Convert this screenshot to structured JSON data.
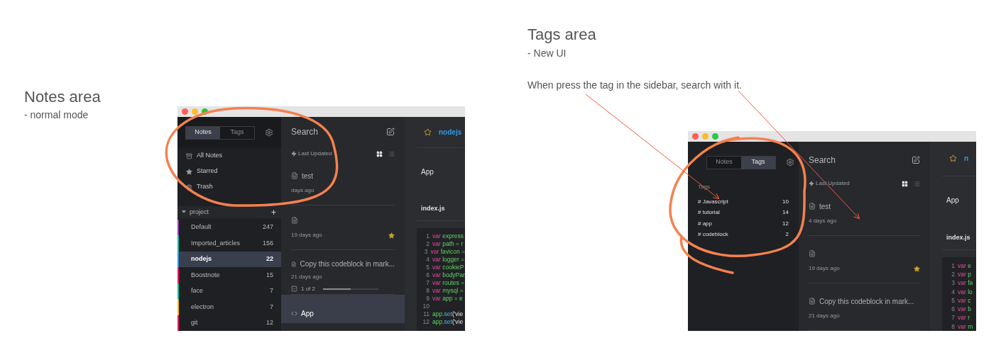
{
  "notes_section": {
    "title": "Notes area",
    "subtitle": "- normal mode",
    "window": {
      "toggle": [
        {
          "label": "Notes",
          "selected": true
        },
        {
          "label": "Tags",
          "selected": false
        }
      ],
      "sidebar": {
        "kind": "notes",
        "nav": [
          {
            "kind": "all",
            "label": "All Notes"
          },
          {
            "kind": "star",
            "label": "Starred"
          },
          {
            "kind": "trash",
            "label": "Trash"
          }
        ],
        "folder_group": {
          "label": "project",
          "expanded": true
        },
        "folders": [
          {
            "name": "Default",
            "count": "247",
            "color": "#8e44ad",
            "selected": false
          },
          {
            "name": "Imported_articles",
            "count": "156",
            "color": "#1abc9c",
            "selected": false
          },
          {
            "name": "nodejs",
            "count": "22",
            "color": "#3498db",
            "selected": true
          },
          {
            "name": "Boostnote",
            "count": "15",
            "color": "#e91e63",
            "selected": false
          },
          {
            "name": "face",
            "count": "7",
            "color": "#1abc9c",
            "selected": false
          },
          {
            "name": "electron",
            "count": "7",
            "color": "#f1c40f",
            "selected": false
          },
          {
            "name": "git",
            "count": "12",
            "color": "#e91e63",
            "selected": false
          }
        ]
      },
      "note_list": {
        "title": "Search",
        "sort_label": "Last Updated",
        "views": [
          {
            "kind": "grid",
            "selected": true
          },
          {
            "kind": "list",
            "selected": false
          }
        ],
        "notes": [
          {
            "kind": "text",
            "title": "test",
            "time": "days ago",
            "starred": false,
            "selected": false
          },
          {
            "kind": "text",
            "time": "19 days ago",
            "starred": true,
            "selected": false
          },
          {
            "kind": "text",
            "title": "Copy this codeblock in mark...",
            "time": "21 days ago",
            "starred": false,
            "selected": false,
            "checklist": {
              "label": "1 of 2",
              "level": 0.5
            }
          },
          {
            "kind": "code",
            "title": "App",
            "selected": true
          }
        ]
      },
      "detail": {
        "folder": "nodejs",
        "title": "App",
        "file": "index.js",
        "code": [
          {
            "number": "1",
            "tokens": [
              {
                "kind": "keyword",
                "text": "var"
              },
              {
                "kind": "name",
                "text": " express"
              }
            ]
          },
          {
            "number": "2",
            "tokens": [
              {
                "kind": "keyword",
                "text": "var"
              },
              {
                "kind": "name",
                "text": " path = r"
              }
            ]
          },
          {
            "number": "3",
            "tokens": [
              {
                "kind": "keyword",
                "text": "var"
              },
              {
                "kind": "name",
                "text": " favicon ="
              }
            ]
          },
          {
            "number": "4",
            "tokens": [
              {
                "kind": "keyword",
                "text": "var"
              },
              {
                "kind": "name",
                "text": " logger ="
              }
            ]
          },
          {
            "number": "5",
            "tokens": [
              {
                "kind": "keyword",
                "text": "var"
              },
              {
                "kind": "name",
                "text": " cookieP"
              }
            ]
          },
          {
            "number": "6",
            "tokens": [
              {
                "kind": "keyword",
                "text": "var"
              },
              {
                "kind": "name",
                "text": " bodyPar"
              }
            ]
          },
          {
            "number": "7",
            "tokens": [
              {
                "kind": "keyword",
                "text": "var"
              },
              {
                "kind": "name",
                "text": " routes ="
              }
            ]
          },
          {
            "number": "8",
            "tokens": [
              {
                "kind": "keyword",
                "text": "var"
              },
              {
                "kind": "name",
                "text": " mysql ="
              }
            ]
          },
          {
            "number": "9",
            "tokens": [
              {
                "kind": "keyword",
                "text": "var"
              },
              {
                "kind": "name",
                "text": " app = e"
              }
            ]
          },
          {
            "number": "10"
          },
          {
            "number": "11",
            "tokens": [
              {
                "kind": "name",
                "text": "app."
              },
              {
                "kind": "function",
                "text": "set"
              },
              {
                "kind": "plain",
                "text": "('vie"
              }
            ]
          },
          {
            "number": "12",
            "tokens": [
              {
                "kind": "name",
                "text": "app."
              },
              {
                "kind": "function",
                "text": "set"
              },
              {
                "kind": "plain",
                "text": "('vie"
              }
            ]
          }
        ]
      }
    }
  },
  "tags_section": {
    "title": "Tags area",
    "subtitle": "- New UI",
    "description": "When press the tag in the sidebar, search with it.",
    "window": {
      "toggle": [
        {
          "label": "Notes",
          "selected": false
        },
        {
          "label": "Tags",
          "selected": true
        }
      ],
      "sidebar": {
        "kind": "tags",
        "heading": "Tags",
        "tags": [
          {
            "label": "# Javascript",
            "count": "10"
          },
          {
            "label": "# tutorial",
            "count": "14"
          },
          {
            "label": "# app",
            "count": "12"
          },
          {
            "label": "# codeblock",
            "count": "2"
          }
        ]
      },
      "note_list": {
        "title": "Search",
        "sort_label": "Last Updated",
        "views": [
          {
            "kind": "grid",
            "selected": true
          },
          {
            "kind": "list",
            "selected": false
          }
        ],
        "notes": [
          {
            "kind": "text",
            "title": "test",
            "time": "4 days ago",
            "starred": false,
            "selected": false
          },
          {
            "kind": "text",
            "time": "19 days ago",
            "starred": true,
            "selected": false
          },
          {
            "kind": "text",
            "title": "Copy this codeblock in mark...",
            "time": "21 days ago",
            "starred": false,
            "selected": false
          }
        ]
      },
      "detail": {
        "folder": "n",
        "title": "App",
        "file": "index.js",
        "code": [
          {
            "number": "1",
            "tokens": [
              {
                "kind": "keyword",
                "text": "var"
              },
              {
                "kind": "name",
                "text": " e"
              }
            ]
          },
          {
            "number": "2",
            "tokens": [
              {
                "kind": "keyword",
                "text": "var"
              },
              {
                "kind": "name",
                "text": " p"
              }
            ]
          },
          {
            "number": "3",
            "tokens": [
              {
                "kind": "keyword",
                "text": "var"
              },
              {
                "kind": "name",
                "text": " fa"
              }
            ]
          },
          {
            "number": "4",
            "tokens": [
              {
                "kind": "keyword",
                "text": "var"
              },
              {
                "kind": "name",
                "text": " lo"
              }
            ]
          },
          {
            "number": "5",
            "tokens": [
              {
                "kind": "keyword",
                "text": "var"
              },
              {
                "kind": "name",
                "text": " c"
              }
            ]
          },
          {
            "number": "6",
            "tokens": [
              {
                "kind": "keyword",
                "text": "var"
              },
              {
                "kind": "name",
                "text": " b"
              }
            ]
          },
          {
            "number": "7",
            "tokens": [
              {
                "kind": "keyword",
                "text": "var"
              },
              {
                "kind": "name",
                "text": " r"
              }
            ]
          },
          {
            "number": "8",
            "tokens": [
              {
                "kind": "keyword",
                "text": "var"
              },
              {
                "kind": "name",
                "text": " m"
              }
            ]
          }
        ]
      }
    }
  }
}
